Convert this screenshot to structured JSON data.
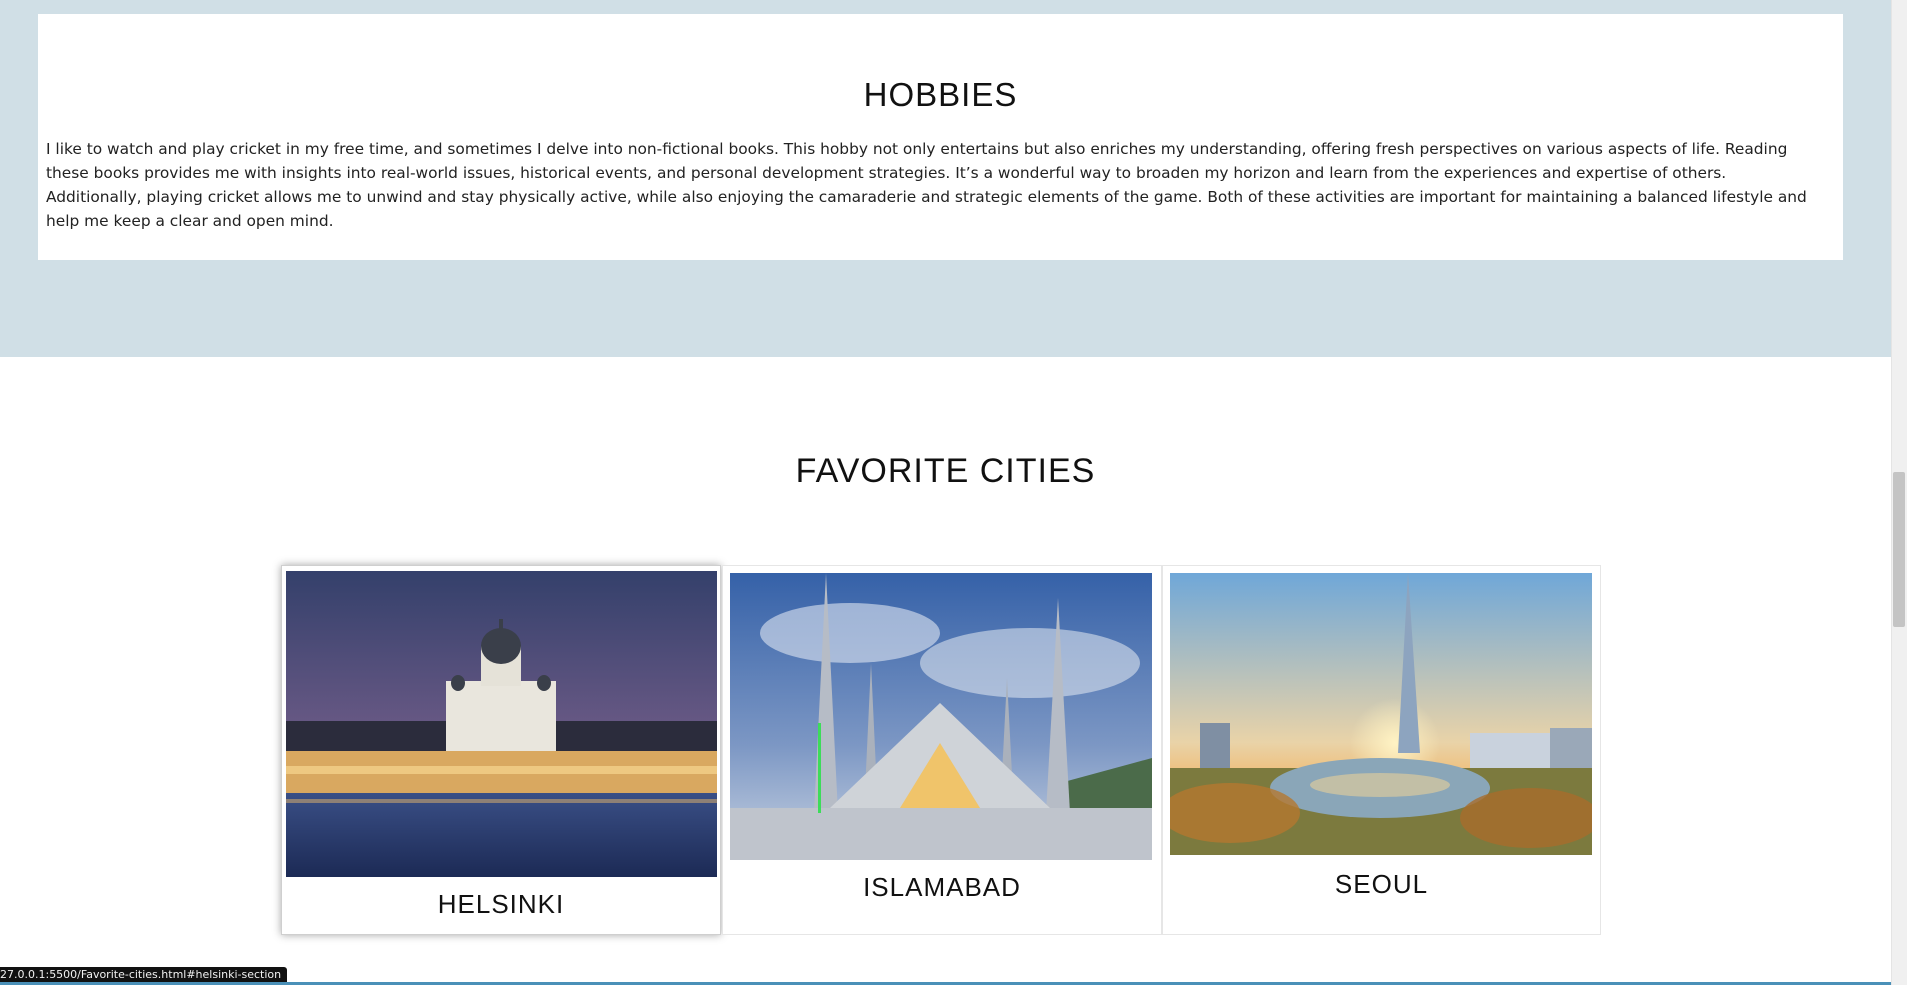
{
  "hobbies": {
    "title": "HOBBIES",
    "text": "I like to watch and play cricket in my free time, and sometimes I delve into non-fictional books. This hobby not only entertains but also enriches my understanding, offering fresh perspectives on various aspects of life. Reading these books provides me with insights into real-world issues, historical events, and personal development strategies. It’s a wonderful way to broaden my horizon and learn from the experiences and expertise of others. Additionally, playing cricket allows me to unwind and stay physically active, while also enjoying the camaraderie and strategic elements of the game. Both of these activities are important for maintaining a balanced lifestyle and help me keep a clear and open mind."
  },
  "cities": {
    "title": "FAVORITE CITIES",
    "items": [
      {
        "name": "HELSINKI",
        "photo": "helsinki-cathedral-night-photo",
        "active": true
      },
      {
        "name": "ISLAMABAD",
        "photo": "faisal-mosque-photo",
        "active": false
      },
      {
        "name": "SEOUL",
        "photo": "lotte-tower-sunset-photo",
        "active": false
      }
    ]
  },
  "status_bar": {
    "url": "27.0.0.1:5500/Favorite-cities.html#helsinki-section"
  },
  "colors": {
    "band_background": "#d0dfe6",
    "card_background": "#ffffff",
    "heading_text": "#111111",
    "body_text": "#222222"
  }
}
